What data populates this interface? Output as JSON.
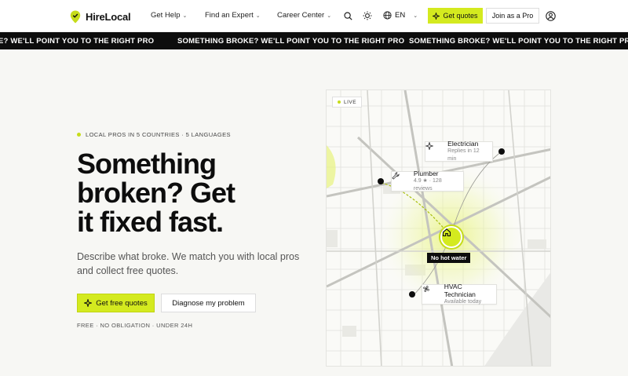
{
  "header": {
    "brand": "HireLocal",
    "nav": [
      {
        "label": "Get Help"
      },
      {
        "label": "Find an Expert"
      },
      {
        "label": "Career Center"
      }
    ],
    "lang": "EN",
    "cta_quotes": "Get quotes",
    "cta_join": "Join as a Pro"
  },
  "ticker": {
    "items": [
      "SOMETHING BROKE? WE'LL POINT YOU TO THE RIGHT PRO",
      "SOMETHING BROKE? WE'LL POINT YOU TO THE RIGHT PRO",
      "SOMETHING BROKE? WE'LL POINT YOU TO THE RIGHT PRO"
    ],
    "lead_fragment": "E? WE'LL POINT YOU TO THE RIGHT PRO"
  },
  "hero": {
    "eyebrow": "LOCAL PROS IN 5 COUNTRIES · 5 LANGUAGES",
    "headline_line1": "Something",
    "headline_line2": "broken? Get",
    "headline_line3": "it fixed fast.",
    "subtext": "Describe what broke. We match you with local pros and collect free quotes.",
    "primary_cta": "Get free quotes",
    "secondary_cta": "Diagnose my problem",
    "footnote": "FREE · NO OBLIGATION · UNDER 24H"
  },
  "map": {
    "live_label": "LIVE",
    "home_label": "No hot water",
    "cards": [
      {
        "title": "Electrician",
        "sub": "Replies in 12 min"
      },
      {
        "title": "Plumber",
        "sub": "4.9 ★ · 128 reviews"
      },
      {
        "title": "HVAC Technician",
        "sub": "Available today"
      }
    ]
  },
  "colors": {
    "accent": "#d4ea1f",
    "ink": "#0d0d0d",
    "background": "#f7f7f4"
  }
}
